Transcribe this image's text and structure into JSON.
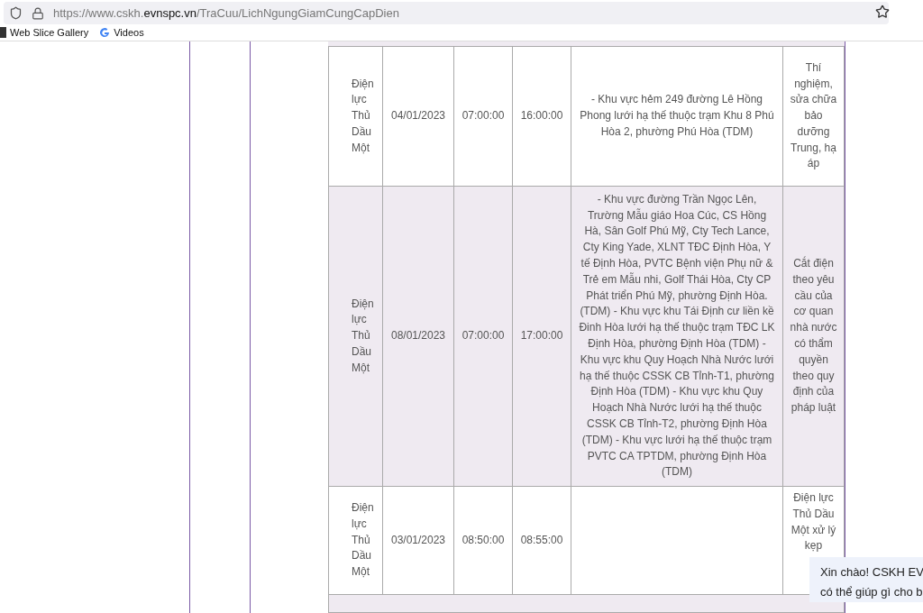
{
  "address_bar": {
    "url_prefix": "https://www.cskh.",
    "url_domain": "evnspc.vn",
    "url_path": "/TraCuu/LichNgungGiamCungCapDien"
  },
  "bookmarks": [
    {
      "kind": "slice",
      "label": "Web Slice Gallery"
    },
    {
      "kind": "google",
      "label": "Videos"
    }
  ],
  "table": {
    "rows": [
      {
        "unit": "Điện lực Thủ Dầu Một",
        "date": "04/01/2023",
        "start": "07:00:00",
        "end": "16:00:00",
        "area": "- Khu vực hẻm 249 đường Lê Hồng Phong lưới hạ thế thuộc trạm Khu 8 Phú Hòa 2, phường Phú Hòa (TDM)",
        "reason": "Thí nghiệm, sửa chữa bảo dưỡng Trung, hạ áp"
      },
      {
        "unit": "Điện lực Thủ Dầu Một",
        "date": "08/01/2023",
        "start": "07:00:00",
        "end": "17:00:00",
        "area": "- Khu vực đường Trần Ngọc Lên, Trường Mẫu giáo Hoa Cúc, CS Hồng Hà, Sân Golf Phú Mỹ, Cty Tech Lance, Cty King Yade, XLNT TĐC Định Hòa, Y tế Định Hòa, PVTC Bệnh viện Phụ nữ & Trẻ em Mẫu nhi, Golf Thái Hòa, Cty CP Phát triển Phú Mỹ, phường Định Hòa. (TDM) - Khu vực khu Tái Định cư liền kề Đinh Hòa lưới hạ thế thuộc trạm TĐC LK Định Hòa, phường Định Hòa (TDM) - Khu vực khu Quy Hoạch Nhà Nước lưới hạ thế thuộc CSSK CB Tỉnh-T1, phường Định Hòa (TDM) - Khu vực khu Quy Hoạch Nhà Nước lưới hạ thế thuộc CSSK CB Tỉnh-T2, phường Định Hòa (TDM) - Khu vực lưới hạ thế thuộc trạm PVTC CA TPTDM, phường Định Hòa (TDM)",
        "reason": "Cắt điện theo yêu cầu của cơ quan nhà nước có thẩm quyền theo quy định của pháp luật"
      },
      {
        "unit": "Điện lực Thủ Dầu Một",
        "date": "03/01/2023",
        "start": "08:50:00",
        "end": "08:55:00",
        "area": "",
        "reason": "Điện lực Thủ Dầu Một xử lý kẹp"
      }
    ]
  },
  "chat_bubble": {
    "lines": [
      "Xin chào! CSKH EV",
      "có thể giúp gì cho b"
    ]
  }
}
